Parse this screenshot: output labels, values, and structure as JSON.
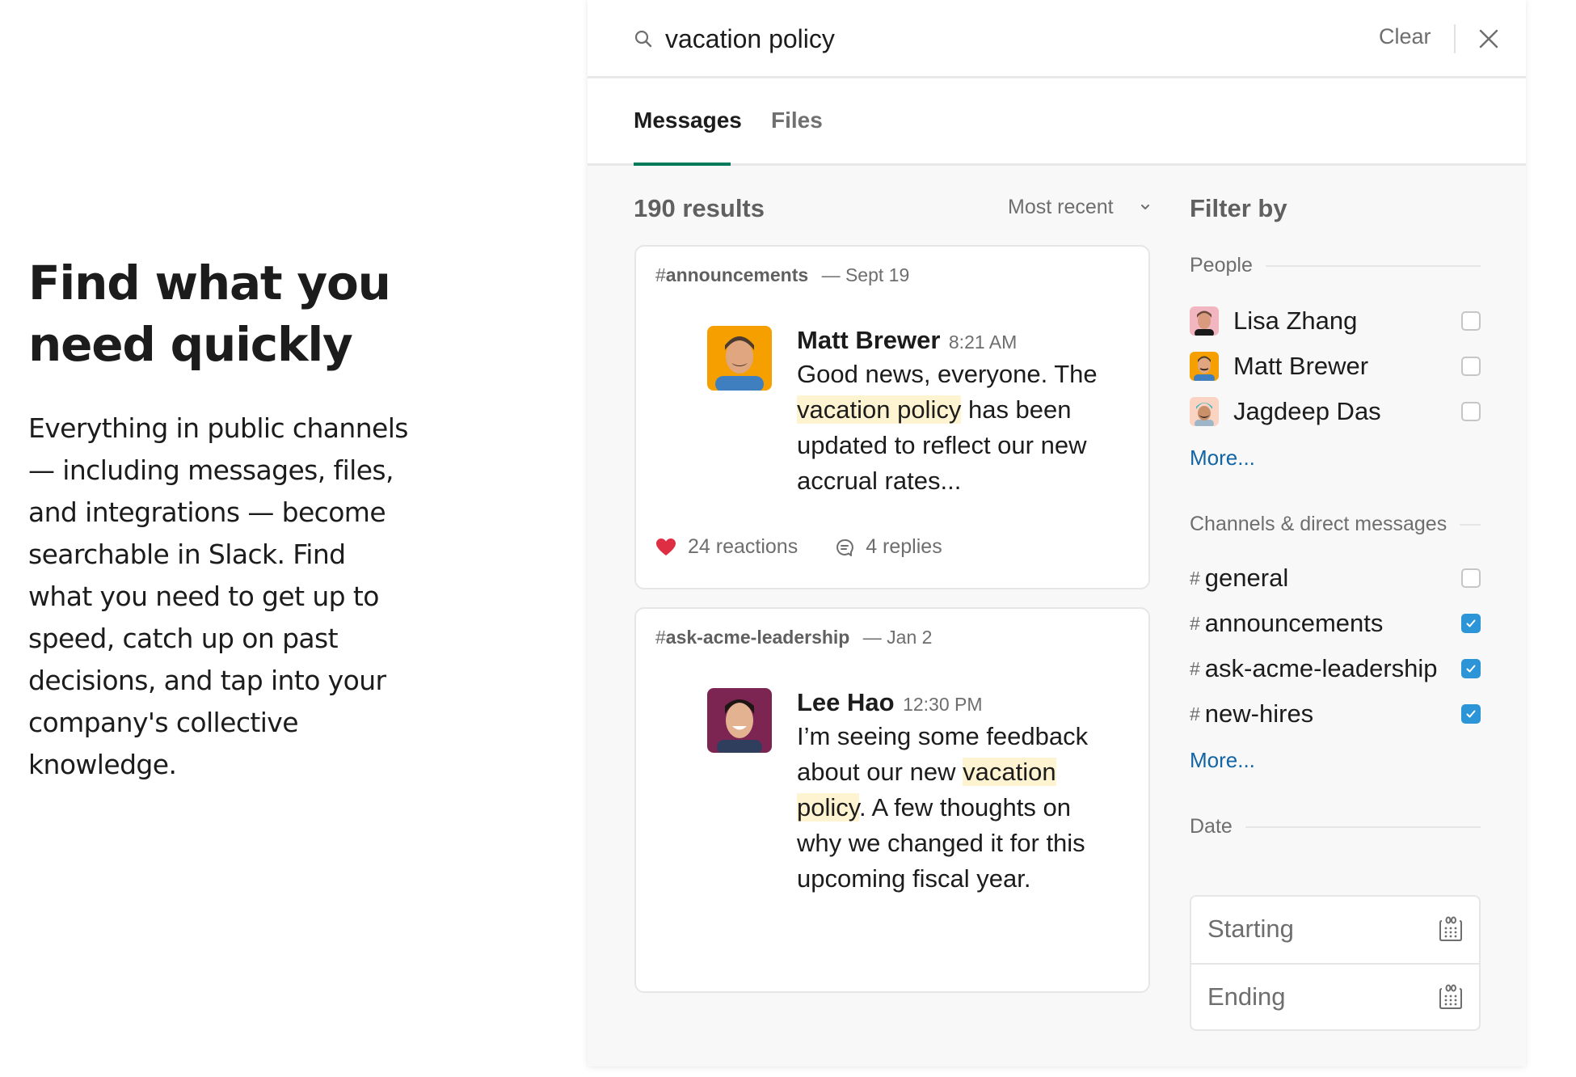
{
  "intro": {
    "heading": "Find what you need quickly",
    "body": "Everything in public channels — including messages, files, and integrations — become searchable in Slack. Find what you need to get up to speed, catch up on past decisions, and tap into your company's collective knowledge."
  },
  "search": {
    "icon": "search-icon",
    "query": "vacation policy",
    "clear_label": "Clear",
    "close_icon": "close-icon"
  },
  "tabs": [
    {
      "label": "Messages",
      "active": true
    },
    {
      "label": "Files",
      "active": false
    }
  ],
  "results": {
    "count_label": "190 results",
    "sort_label": "Most recent",
    "sort_icon": "chevron-down-icon"
  },
  "messages": [
    {
      "channel": "announcements",
      "date": "— Sept 19",
      "author": "Matt Brewer",
      "time": "8:21 AM",
      "text_before": "Good news, everyone. The ",
      "highlight": "vacation policy",
      "text_after": " has been updated to reflect our new accrual rates...",
      "reactions_label": "24 reactions",
      "reaction_icon": "heart-icon",
      "replies_label": "4 replies",
      "replies_icon": "reply-bubble-icon",
      "avatar_bg": "#f5a000"
    },
    {
      "channel": "ask-acme-leadership",
      "date": "— Jan 2",
      "author": "Lee Hao",
      "time": "12:30 PM",
      "text_before": "I’m seeing some feedback about our new ",
      "highlight": "vacation policy",
      "text_after": ". A few thoughts on why we changed it for this upcoming fiscal year.",
      "avatar_bg": "#7c2452"
    }
  ],
  "filter": {
    "title": "Filter by",
    "people_label": "People",
    "people": [
      {
        "name": "Lisa Zhang",
        "checked": false,
        "avatar_bg": "#f2b6c0"
      },
      {
        "name": "Matt Brewer",
        "checked": false,
        "avatar_bg": "#f5a000"
      },
      {
        "name": "Jagdeep Das",
        "checked": false,
        "avatar_bg": "#fbd3c2"
      }
    ],
    "people_more": "More...",
    "channels_label": "Channels & direct messages",
    "channels": [
      {
        "name": "general",
        "checked": false
      },
      {
        "name": "announcements",
        "checked": true
      },
      {
        "name": "ask-acme-leadership",
        "checked": true
      },
      {
        "name": "new-hires",
        "checked": true
      }
    ],
    "channels_more": "More...",
    "date_label": "Date",
    "date_start_placeholder": "Starting",
    "date_end_placeholder": "Ending",
    "calendar_icon": "calendar-icon"
  },
  "colors": {
    "accent_green": "#007a5a",
    "link_blue": "#1264a3",
    "checkbox_blue": "#2b95d8",
    "highlight": "#fff4d1"
  }
}
